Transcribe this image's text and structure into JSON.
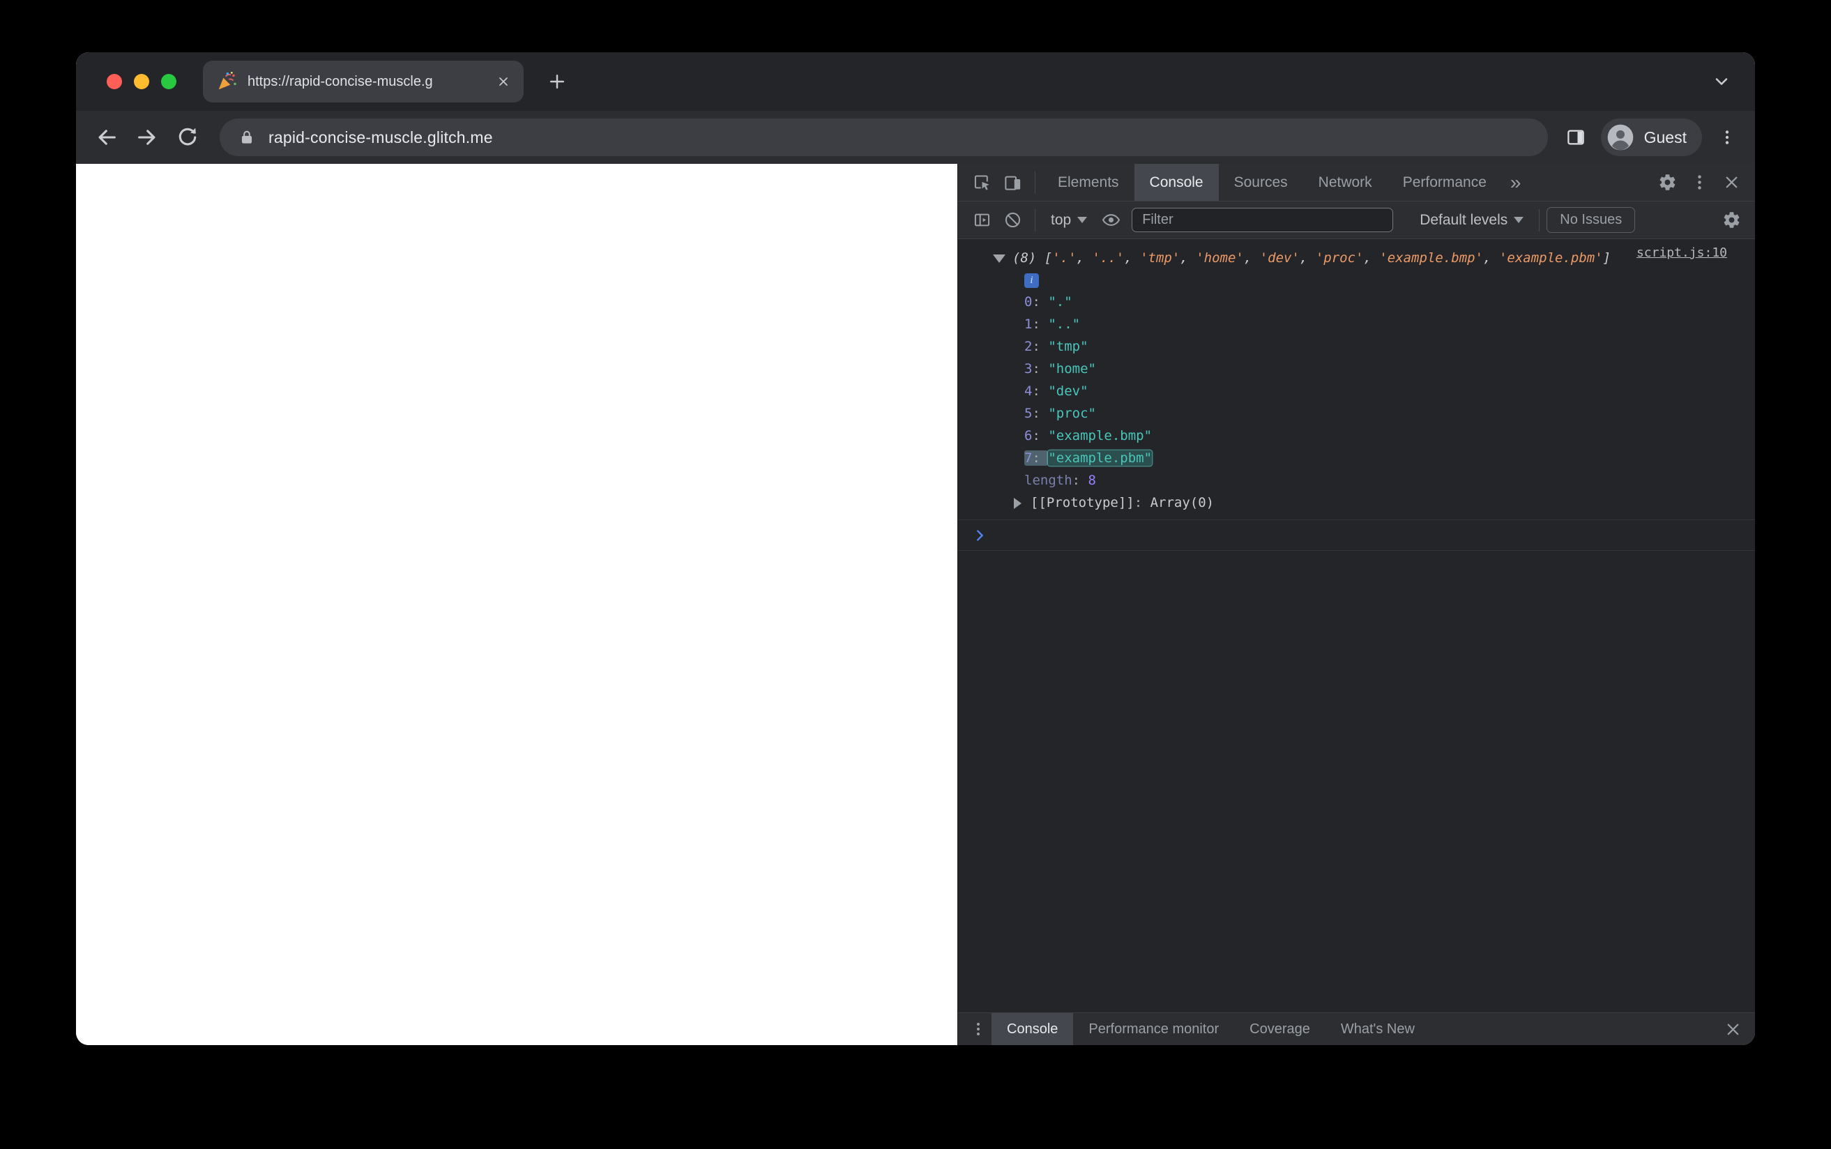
{
  "browser": {
    "tab_title": "https://rapid-concise-muscle.g",
    "url": "rapid-concise-muscle.glitch.me",
    "profile": "Guest"
  },
  "devtools": {
    "tabs": [
      "Elements",
      "Console",
      "Sources",
      "Network",
      "Performance"
    ],
    "more_tabs_glyph": "»",
    "subbar": {
      "context": "top",
      "filter_placeholder": "Filter",
      "levels": "Default levels",
      "issues": "No Issues"
    },
    "console": {
      "source_link": "script.js:10",
      "preview": {
        "count": "(8) ",
        "open": "[",
        "comma": ", ",
        "close": "]",
        "items": [
          "'.'",
          "'..'",
          "'tmp'",
          "'home'",
          "'dev'",
          "'proc'",
          "'example.bmp'",
          "'example.pbm'"
        ]
      },
      "info_glyph": "i",
      "punct": {
        "colon": ": "
      },
      "entries": [
        {
          "key": "0",
          "value": "\".\""
        },
        {
          "key": "1",
          "value": "\"..\""
        },
        {
          "key": "2",
          "value": "\"tmp\""
        },
        {
          "key": "3",
          "value": "\"home\""
        },
        {
          "key": "4",
          "value": "\"dev\""
        },
        {
          "key": "5",
          "value": "\"proc\""
        },
        {
          "key": "6",
          "value": "\"example.bmp\""
        },
        {
          "key": "7",
          "value": "\"example.pbm\"",
          "highlighted": true
        }
      ],
      "length_key": "length",
      "length_value": "8",
      "proto_key": "[[Prototype]]",
      "proto_value": "Array(0)"
    },
    "drawer": {
      "tabs": [
        "Console",
        "Performance monitor",
        "Coverage",
        "What's New"
      ]
    }
  },
  "colors": {
    "string_value": "#49c5b9",
    "preview_string": "#ec9a65",
    "index_key": "#8b91d9",
    "number_value": "#9980ff",
    "prompt_accent": "#4e86ec",
    "traffic_red": "#ff5f57",
    "traffic_yellow": "#febc2e",
    "traffic_green": "#28c840"
  }
}
